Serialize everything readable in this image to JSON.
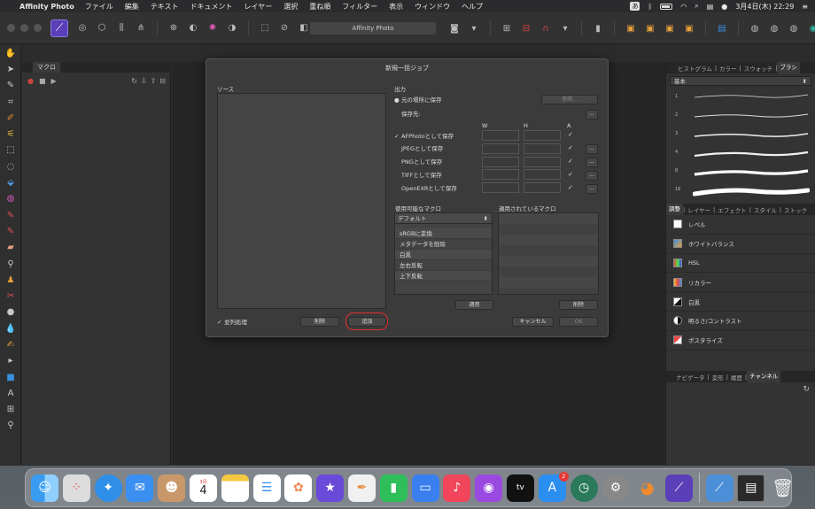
{
  "menubar": {
    "app_name": "Affinity Photo",
    "menus": [
      "ファイル",
      "編集",
      "テキスト",
      "ドキュメント",
      "レイヤー",
      "選択",
      "重ね順",
      "フィルター",
      "表示",
      "ウィンドウ",
      "ヘルプ"
    ],
    "input_indicator": "あ",
    "clock": "3月4日(木) 22:29"
  },
  "titlebar": {
    "document_title": "Affinity Photo"
  },
  "left_panel": {
    "tab_label": "マクロ"
  },
  "right_panel": {
    "top_tabs": [
      "ヒストグラム",
      "カラー",
      "スウォッチ",
      "ブラシ"
    ],
    "brush_category": "基本",
    "brush_sizes": [
      "1",
      "2",
      "3",
      "4",
      "8",
      "16"
    ],
    "adjust_tabs": [
      "調整",
      "レイヤー",
      "エフェクト",
      "スタイル",
      "ストック"
    ],
    "adjustments": [
      "レベル",
      "ホワイトバランス",
      "HSL",
      "リカラー",
      "白黒",
      "明るさ/コントラスト",
      "ポスタライズ"
    ],
    "bottom_tabs": [
      "ナビゲータ",
      "変形",
      "履歴",
      "チャンネル"
    ]
  },
  "dialog": {
    "title": "新規一括ジョブ",
    "source_label": "ソース",
    "output_label": "出力",
    "radio_same_location": "元の場所に保存",
    "radio_save_to": "保存先:",
    "browse_button": "参照...",
    "more_button": "...",
    "col_w": "W",
    "col_h": "H",
    "col_a": "A",
    "formats": [
      {
        "label": "AFPhotoとして保存",
        "checked": true
      },
      {
        "label": "JPEGとして保存",
        "checked": false
      },
      {
        "label": "PNGとして保存",
        "checked": false
      },
      {
        "label": "TIFFとして保存",
        "checked": false
      },
      {
        "label": "OpenEXRとして保存",
        "checked": false
      }
    ],
    "available_macros_label": "使用可能なマクロ",
    "macro_library": "デフォルト",
    "macros": [
      "sRGBに変換",
      "メタデータを削除",
      "白黒",
      "左右反転",
      "上下反転"
    ],
    "applied_macros_label": "適用されているマクロ",
    "apply_button": "適用",
    "remove_macro_button": "削除",
    "parallel_label": "並列処理",
    "delete_button": "削除",
    "add_button": "追加",
    "cancel_button": "キャンセル",
    "ok_button": "OK"
  },
  "dock": {
    "calendar_month": "3月",
    "calendar_day": "4",
    "appstore_badge": "2"
  }
}
